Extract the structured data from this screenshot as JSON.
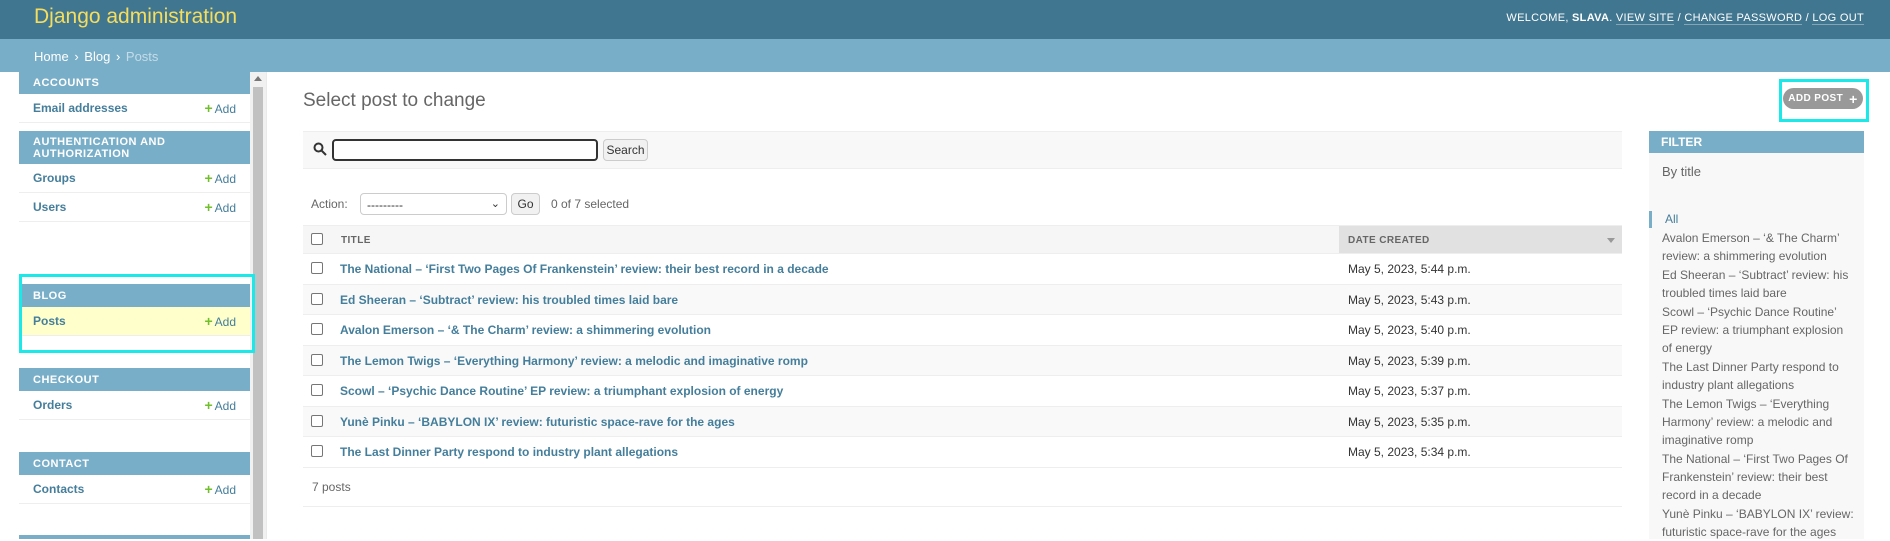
{
  "header": {
    "brand": "Django administration",
    "welcome": "WELCOME,",
    "username": "SLAVA",
    "view_site": "VIEW SITE",
    "change_password": "CHANGE PASSWORD",
    "log_out": "LOG OUT",
    "sep": "/"
  },
  "breadcrumbs": {
    "home": "Home",
    "blog": "Blog",
    "current": "Posts",
    "sep": "›"
  },
  "sidebar": {
    "add_label": "Add",
    "modules": [
      {
        "caption": "ACCOUNTS",
        "items": [
          {
            "label": "Email addresses"
          }
        ]
      },
      {
        "caption": "AUTHENTICATION AND AUTHORIZATION",
        "items": [
          {
            "label": "Groups"
          },
          {
            "label": "Users"
          }
        ]
      },
      {
        "caption": "BLOG",
        "items": [
          {
            "label": "Posts"
          }
        ]
      },
      {
        "caption": "CHECKOUT",
        "items": [
          {
            "label": "Orders"
          }
        ]
      },
      {
        "caption": "CONTACT",
        "items": [
          {
            "label": "Contacts"
          }
        ]
      }
    ]
  },
  "content": {
    "title": "Select post to change",
    "add_button": "ADD POST",
    "search": {
      "value": "",
      "button": "Search"
    },
    "actions": {
      "label": "Action:",
      "selected_option": "---------",
      "go": "Go",
      "counter": "0 of 7 selected"
    },
    "table": {
      "columns": [
        "TITLE",
        "DATE CREATED"
      ],
      "rows": [
        {
          "title": "The National – ‘First Two Pages Of Frankenstein’ review: their best record in a decade",
          "date": "May 5, 2023, 5:44 p.m."
        },
        {
          "title": "Ed Sheeran – ‘Subtract’ review: his troubled times laid bare",
          "date": "May 5, 2023, 5:43 p.m."
        },
        {
          "title": "Avalon Emerson – ‘& The Charm’ review: a shimmering evolution",
          "date": "May 5, 2023, 5:40 p.m."
        },
        {
          "title": "The Lemon Twigs – ‘Everything Harmony’ review: a melodic and imaginative romp",
          "date": "May 5, 2023, 5:39 p.m."
        },
        {
          "title": "Scowl – ‘Psychic Dance Routine’ EP review: a triumphant explosion of energy",
          "date": "May 5, 2023, 5:37 p.m."
        },
        {
          "title": "Yunè Pinku – ‘BABYLON IX’ review: futuristic space-rave for the ages",
          "date": "May 5, 2023, 5:35 p.m."
        },
        {
          "title": "The Last Dinner Party respond to industry plant allegations",
          "date": "May 5, 2023, 5:34 p.m."
        }
      ]
    },
    "paginator": "7 posts"
  },
  "filter": {
    "title": "FILTER",
    "by": "By title",
    "all": "All",
    "items": [
      "Avalon Emerson – ‘& The Charm’ review: a shimmering evolution",
      "Ed Sheeran – ‘Subtract’ review: his troubled times laid bare",
      "Scowl – ‘Psychic Dance Routine’ EP review: a triumphant explosion of energy",
      "The Last Dinner Party respond to industry plant allegations",
      "The Lemon Twigs – ‘Everything Harmony’ review: a melodic and imaginative romp",
      "The National – ‘First Two Pages Of Frankenstein’ review: their best record in a decade",
      "Yunè Pinku – ‘BABYLON IX’ review: futuristic space-rave for the ages"
    ]
  },
  "colors": {
    "header_bg": "#417690",
    "brand": "#f5dd5d",
    "module_caption": "#79aec8",
    "link": "#447e9b",
    "add_plus": "#70bf2b",
    "selected_row": "#ffffcc",
    "highlight": "#1be8e8"
  },
  "icons": [
    "search-icon",
    "plus-icon",
    "sort-desc-icon",
    "chevron-down-icon"
  ]
}
